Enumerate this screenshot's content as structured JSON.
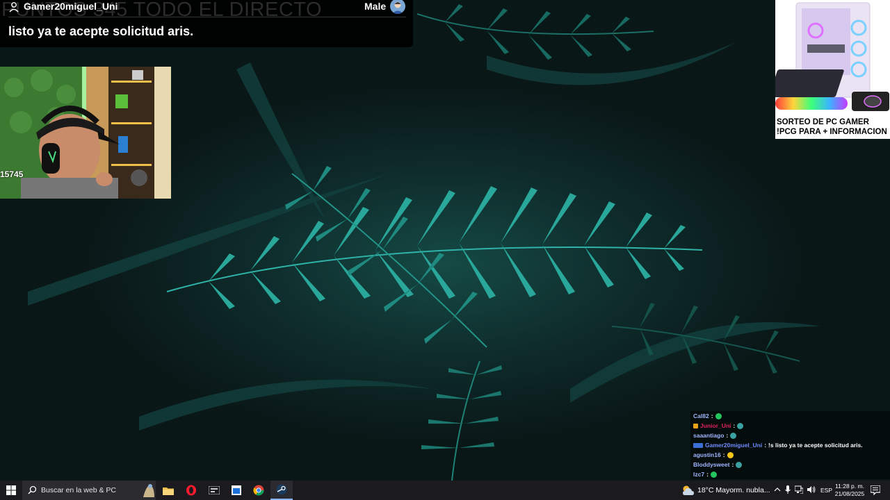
{
  "alert": {
    "ghost_text": "PUNTOS 345 TODO EL DIRECTO",
    "username": "Gamer20miguel_Uni",
    "voice": "Male",
    "message": "listo ya te acepte solicitud aris."
  },
  "webcam": {
    "overlay_count": "15745"
  },
  "ad": {
    "line1": "SORTEO DE PC GAMER",
    "line2": "!PCG PARA + INFORMACION"
  },
  "chat": {
    "messages": [
      {
        "user": "Cal82",
        "text": "",
        "user_color": "#9fb6ff",
        "emote_color": "#22c55e"
      },
      {
        "user": "Junior_Uni",
        "text": "",
        "user_color": "#e0245e",
        "emote_color": "#3aa0a0"
      },
      {
        "user": "saaantiago",
        "text": "",
        "user_color": "#9fb6ff",
        "emote_color": "#3aa0a0"
      },
      {
        "user": "Gamer20miguel_Uni",
        "text": "!s listo ya te acepte solicitud aris.",
        "user_color": "#6f8cff",
        "emote_color": ""
      },
      {
        "user": "agustin16",
        "text": "",
        "user_color": "#9fb6ff",
        "emote_color": "#f5c518"
      },
      {
        "user": "Bloddysweet",
        "text": "",
        "user_color": "#9fb6ff",
        "emote_color": "#3aa0a0"
      },
      {
        "user": "lzc7",
        "text": "",
        "user_color": "#9fb6ff",
        "emote_color": "#22c55e"
      }
    ]
  },
  "taskbar": {
    "search_placeholder": "Buscar en la web & PC",
    "weather": "18°C  Mayorm. nubla...",
    "language": "ESP",
    "time": "11:28 p. m.",
    "date": "21/08/2025"
  }
}
